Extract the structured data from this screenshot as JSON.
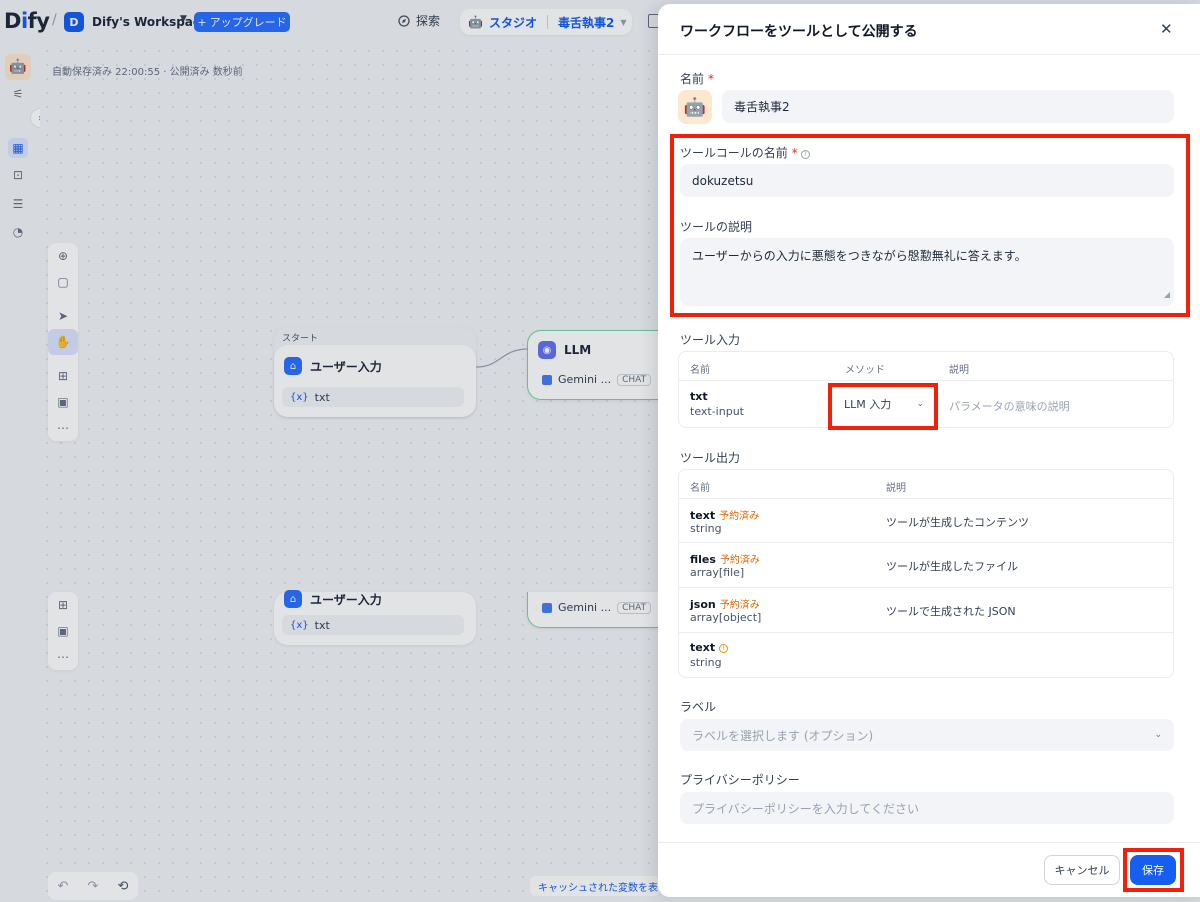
{
  "topbar": {
    "logo": "Dify",
    "workspace_initial": "D",
    "workspace_name": "Dify's Workspace",
    "upgrade_label": "アップグレード",
    "explore_label": "探索",
    "studio_label": "スタジオ",
    "app_name": "毒舌執事2"
  },
  "canvas": {
    "autosave_text": "自動保存済み 22:00:55 · 公開済み 数秒前",
    "start_node_label": "スタート",
    "start_node_title": "ユーザー入力",
    "start_var": "txt",
    "llm_node_title": "LLM",
    "llm_model": "Gemini ...",
    "chat_tag": "CHAT",
    "start_node2_title": "ユーザー入力",
    "start_var2": "txt",
    "llm_model2": "Gemini ...",
    "chat_tag2": "CHAT",
    "cache_button": "キャッシュされた変数を表"
  },
  "modal": {
    "title": "ワークフローをツールとして公開する",
    "name_label": "名前",
    "name_value": "毒舌執事2",
    "tool_call_name_label": "ツールコールの名前",
    "tool_call_name_value": "dokuzetsu",
    "tool_desc_label": "ツールの説明",
    "tool_desc_value": "ユーザーからの入力に悪態をつきながら慇懃無礼に答えます。",
    "tool_input_label": "ツール入力",
    "input_headers": {
      "name": "名前",
      "method": "メソッド",
      "desc": "説明"
    },
    "input_rows": [
      {
        "name": "txt",
        "type": "text-input",
        "method": "LLM 入力",
        "desc_placeholder": "パラメータの意味の説明"
      }
    ],
    "tool_output_label": "ツール出力",
    "output_headers": {
      "name": "名前",
      "desc": "説明"
    },
    "output_rows": [
      {
        "name": "text",
        "tag": "予約済み",
        "type": "string",
        "desc": "ツールが生成したコンテンツ"
      },
      {
        "name": "files",
        "tag": "予約済み",
        "type": "array[file]",
        "desc": "ツールが生成したファイル"
      },
      {
        "name": "json",
        "tag": "予約済み",
        "type": "array[object]",
        "desc": "ツールで生成された JSON"
      },
      {
        "name": "text",
        "tag": "",
        "type": "string",
        "desc": ""
      }
    ],
    "label_label": "ラベル",
    "label_placeholder": "ラベルを選択します (オプション)",
    "privacy_label": "プライバシーポリシー",
    "privacy_placeholder": "プライバシーポリシーを入力してください",
    "cancel_label": "キャンセル",
    "save_label": "保存"
  },
  "colors": {
    "accent": "#155eef",
    "highlight": "#f2200a",
    "reserved": "#dc6803"
  }
}
